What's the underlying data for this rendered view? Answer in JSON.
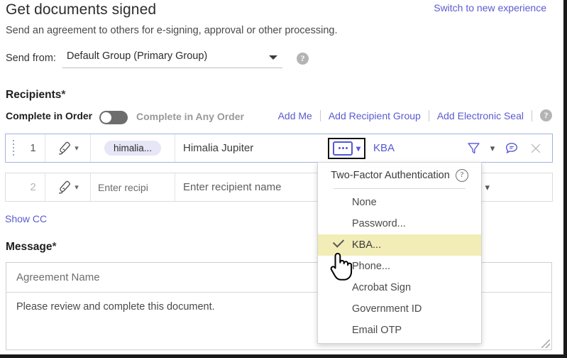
{
  "header": {
    "title": "Get documents signed",
    "subtitle": "Send an agreement to others for e-signing, approval or other processing.",
    "switch_link": "Switch to new experience"
  },
  "send_from": {
    "label": "Send from:",
    "value": "Default Group (Primary Group)",
    "help_icon": "help-circle-icon",
    "caret_icon": "caret-down-icon"
  },
  "recipients": {
    "heading": "Recipients",
    "required_mark": "*",
    "complete_in_order_label": "Complete in Order",
    "complete_in_any_order_label": "Complete in Any Order",
    "toggle_state": "off",
    "links": [
      {
        "label": "Add Me"
      },
      {
        "label": "Add Recipient Group"
      },
      {
        "label": "Add Electronic Seal"
      }
    ],
    "help_icon": "help-circle-icon",
    "rows": [
      {
        "number": "1",
        "role_icon": "signature-pen-icon",
        "role_chevron": "chevron-down-icon",
        "email_chip": "himalia...",
        "name": "Himalia Jupiter",
        "auth_icon": "password-dots-icon",
        "auth_chevron": "chevron-down-icon",
        "auth_label": "KBA",
        "filter_icon": "funnel-icon",
        "filter_chevron": "chevron-down-icon",
        "message_icon": "speech-bubble-icon",
        "delete_icon": "close-x-icon"
      },
      {
        "number": "2",
        "role_icon": "signature-pen-icon",
        "role_chevron": "chevron-down-icon",
        "email_placeholder": "Enter recipi",
        "name_placeholder": "Enter recipient name",
        "auth_chevron": "chevron-down-icon"
      }
    ],
    "show_cc": "Show CC"
  },
  "auth_dropdown": {
    "header": "Two-Factor Authentication",
    "help_icon": "question-circle-icon",
    "items": [
      {
        "label": "None",
        "selected": false
      },
      {
        "label": "Password...",
        "selected": false
      },
      {
        "label": "KBA...",
        "selected": true
      },
      {
        "label": "Phone...",
        "selected": false
      },
      {
        "label": "Acrobat Sign",
        "selected": false
      },
      {
        "label": "Government ID",
        "selected": false
      },
      {
        "label": "Email OTP",
        "selected": false
      }
    ]
  },
  "message": {
    "heading": "Message",
    "required_mark": "*",
    "agreement_name_placeholder": "Agreement Name",
    "body_text": "Please review and complete this document."
  },
  "cursor": {
    "type": "pointing-hand-cursor"
  },
  "colors": {
    "link_blue": "#5b5bd0",
    "accent_blue": "#5656d6",
    "highlight_yellow": "#f2edb6",
    "row_focus_border": "#9fb4dd",
    "chip_bg": "#e6e6f6"
  }
}
